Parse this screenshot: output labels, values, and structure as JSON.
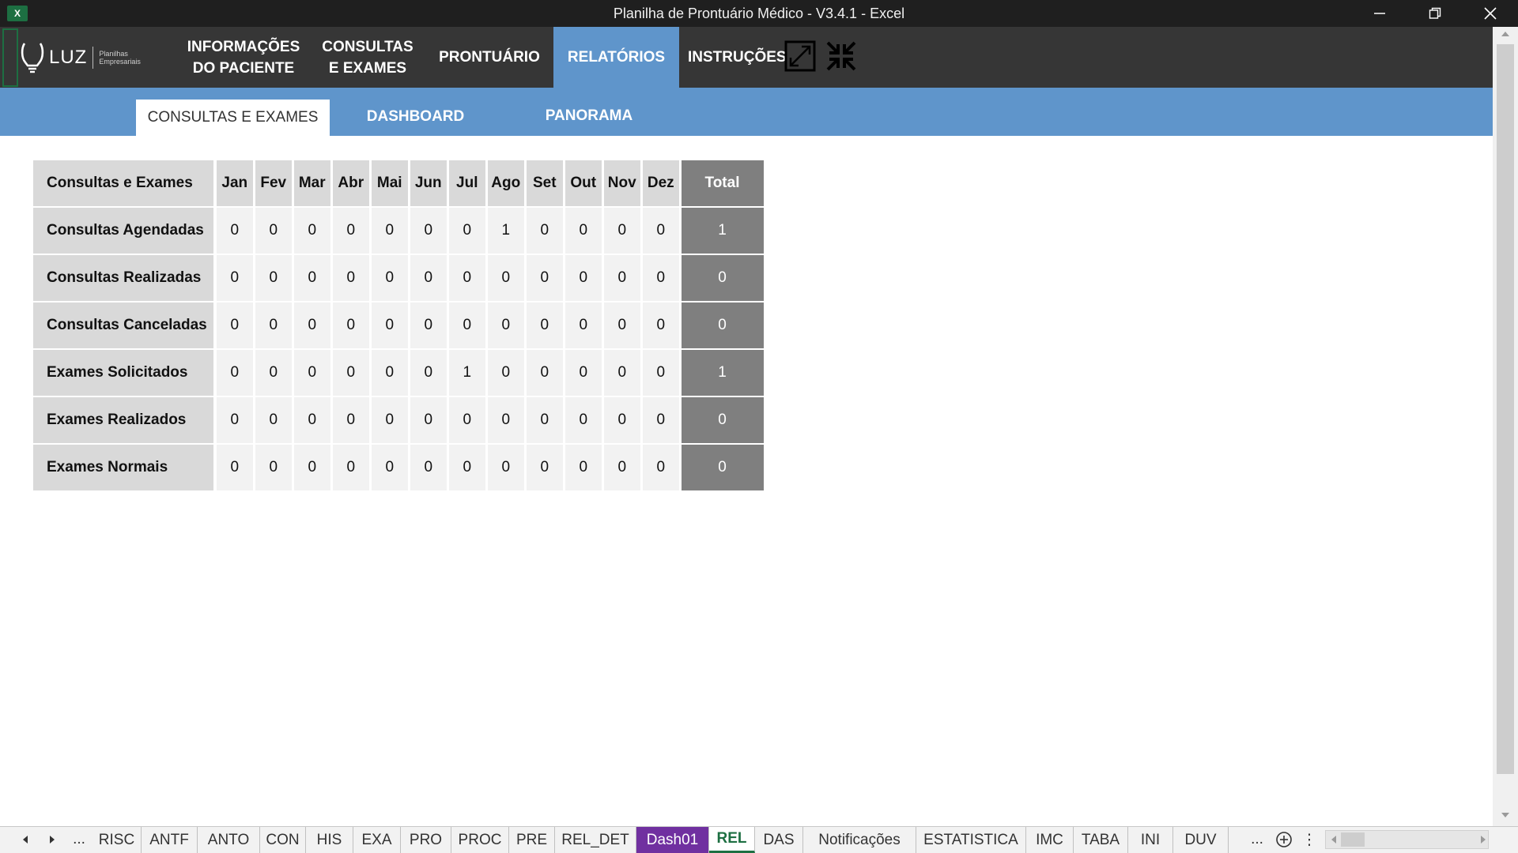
{
  "window": {
    "app_icon": "excel-icon",
    "title": "Planilha de Prontuário Médico - V3.4.1 - Excel",
    "controls": [
      "minimize-icon",
      "restore-icon",
      "close-icon"
    ]
  },
  "brand": {
    "logo_text": "LUZ",
    "logo_sub_1": "Planilhas",
    "logo_sub_2": "Empresariais"
  },
  "nav": {
    "items": [
      {
        "line1": "INFORMAÇÕES",
        "line2": "DO PACIENTE"
      },
      {
        "line1": "CONSULTAS",
        "line2": "E EXAMES"
      },
      {
        "label": "PRONTUÁRIO"
      },
      {
        "label": "RELATÓRIOS",
        "active": true
      },
      {
        "label": "INSTRUÇÕES"
      }
    ],
    "icons": [
      "expand-icon",
      "compress-icon"
    ]
  },
  "subnav": {
    "tabs": [
      "CONSULTAS E EXAMES",
      "DASHBOARD",
      "PANORAMA"
    ],
    "active": "CONSULTAS E EXAMES"
  },
  "report": {
    "header": {
      "label": "Consultas e Exames",
      "months": [
        "Jan",
        "Fev",
        "Mar",
        "Abr",
        "Mai",
        "Jun",
        "Jul",
        "Ago",
        "Set",
        "Out",
        "Nov",
        "Dez"
      ],
      "total": "Total"
    },
    "rows": [
      {
        "label": "Consultas Agendadas",
        "values": [
          "0",
          "0",
          "0",
          "0",
          "0",
          "0",
          "0",
          "1",
          "0",
          "0",
          "0",
          "0"
        ],
        "total": "1"
      },
      {
        "label": "Consultas Realizadas",
        "values": [
          "0",
          "0",
          "0",
          "0",
          "0",
          "0",
          "0",
          "0",
          "0",
          "0",
          "0",
          "0"
        ],
        "total": "0"
      },
      {
        "label": "Consultas Canceladas",
        "values": [
          "0",
          "0",
          "0",
          "0",
          "0",
          "0",
          "0",
          "0",
          "0",
          "0",
          "0",
          "0"
        ],
        "total": "0"
      },
      {
        "label": "Exames Solicitados",
        "values": [
          "0",
          "0",
          "0",
          "0",
          "0",
          "0",
          "1",
          "0",
          "0",
          "0",
          "0",
          "0"
        ],
        "total": "1"
      },
      {
        "label": "Exames Realizados",
        "values": [
          "0",
          "0",
          "0",
          "0",
          "0",
          "0",
          "0",
          "0",
          "0",
          "0",
          "0",
          "0"
        ],
        "total": "0"
      },
      {
        "label": "Exames Normais",
        "values": [
          "0",
          "0",
          "0",
          "0",
          "0",
          "0",
          "0",
          "0",
          "0",
          "0",
          "0",
          "0"
        ],
        "total": "0"
      }
    ]
  },
  "sheet_tabs": {
    "ellipsis_left": "...",
    "tabs": [
      "RISC",
      "ANTF",
      "ANTO",
      "CON",
      "HIS",
      "EXA",
      "PRO",
      "PROC",
      "PRE",
      "REL_DET",
      "Dash01",
      "REL",
      "DAS",
      "Notificações",
      "ESTATISTICA",
      "IMC",
      "TABA",
      "INI",
      "DUV"
    ],
    "active": "REL",
    "highlighted": "Dash01",
    "ellipsis_right": "...",
    "add_label": "+",
    "more_label": "⋮"
  },
  "colors": {
    "nav_dark": "#363636",
    "accent_blue": "#5f95cb",
    "total_gray": "#7f7f7f",
    "label_gray": "#d9d9d9",
    "excel_green": "#1d6f42",
    "tab_purple": "#7030a0"
  }
}
